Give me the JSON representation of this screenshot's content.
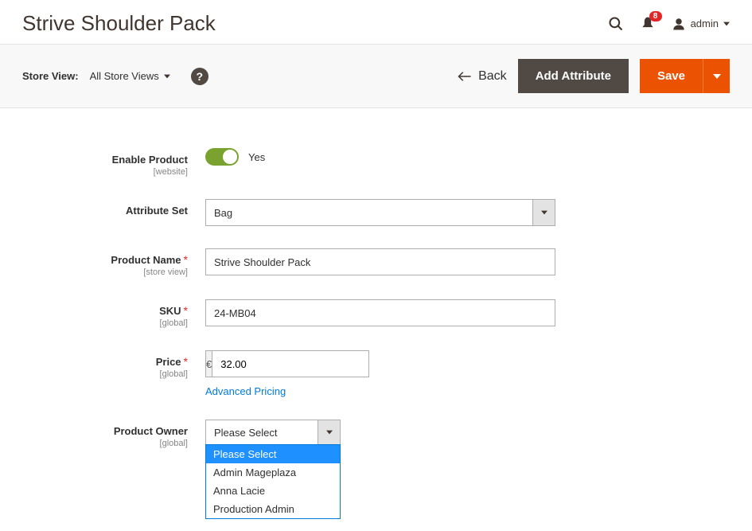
{
  "header": {
    "title": "Strive Shoulder Pack",
    "notification_count": "8",
    "username": "admin"
  },
  "toolbar": {
    "store_view_label": "Store View:",
    "store_view_value": "All Store Views",
    "back_label": "Back",
    "add_attribute_label": "Add Attribute",
    "save_label": "Save"
  },
  "form": {
    "enable_product": {
      "label": "Enable Product",
      "scope": "[website]",
      "value_label": "Yes"
    },
    "attribute_set": {
      "label": "Attribute Set",
      "value": "Bag"
    },
    "product_name": {
      "label": "Product Name",
      "scope": "[store view]",
      "value": "Strive Shoulder Pack"
    },
    "sku": {
      "label": "SKU",
      "scope": "[global]",
      "value": "24-MB04"
    },
    "price": {
      "label": "Price",
      "scope": "[global]",
      "currency": "€",
      "value": "32.00",
      "advanced_link": "Advanced Pricing"
    },
    "product_owner": {
      "label": "Product Owner",
      "scope": "[global]",
      "selected": "Please Select",
      "options": [
        "Please Select",
        "Admin Mageplaza",
        "Anna Lacie",
        "Production Admin"
      ]
    }
  }
}
